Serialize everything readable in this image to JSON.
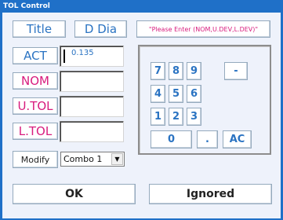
{
  "window": {
    "title": "TOL Control"
  },
  "header": {
    "title_button": "Title",
    "ddia_button": "D Dia",
    "prompt": "\"Please Enter (NOM,U.DEV,L.DEV)\""
  },
  "form": {
    "act_label": "ACT",
    "act_value": "0.135",
    "nom_label": "NOM",
    "nom_value": "",
    "utol_label": "U.TOL",
    "utol_value": "",
    "ltol_label": "L.TOL",
    "ltol_value": "",
    "modify_label": "Modify",
    "combo_value": "Combo 1",
    "combo_arrow": "▼"
  },
  "keypad": {
    "k7": "7",
    "k8": "8",
    "k9": "9",
    "minus": "-",
    "k4": "4",
    "k5": "5",
    "k6": "6",
    "k1": "1",
    "k2": "2",
    "k3": "3",
    "k0": "0",
    "dot": ".",
    "ac": "AC"
  },
  "footer": {
    "ok": "OK",
    "ignored": "Ignored"
  },
  "colors": {
    "titlebar": "#1f70c8",
    "accent_blue": "#2a73c2",
    "accent_pink": "#d81b7d",
    "background": "#eef2fb"
  }
}
